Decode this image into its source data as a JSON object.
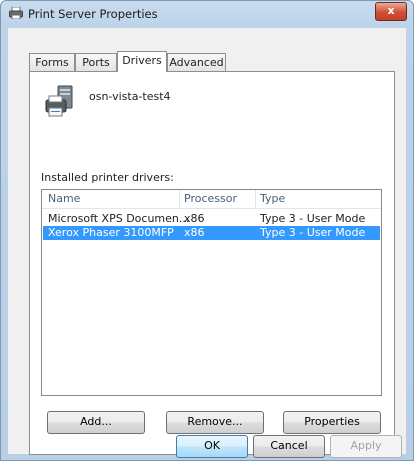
{
  "window": {
    "title": "Print Server Properties",
    "close_glyph": "x"
  },
  "tabs": [
    {
      "label": "Forms",
      "active": false
    },
    {
      "label": "Ports",
      "active": false
    },
    {
      "label": "Drivers",
      "active": true
    },
    {
      "label": "Advanced",
      "active": false
    }
  ],
  "server": {
    "name": "osn-vista-test4",
    "icon": "printer-server-icon"
  },
  "drivers": {
    "label": "Installed printer drivers:",
    "columns": [
      "Name",
      "Processor",
      "Type"
    ],
    "rows": [
      {
        "name": "Microsoft XPS Documen...",
        "processor": "x86",
        "type": "Type 3 - User Mode",
        "selected": false
      },
      {
        "name": "Xerox Phaser 3100MFP",
        "processor": "x86",
        "type": "Type 3 - User Mode",
        "selected": true
      }
    ]
  },
  "panel_buttons": {
    "add": "Add...",
    "remove": "Remove...",
    "properties": "Properties"
  },
  "dialog_buttons": {
    "ok": "OK",
    "cancel": "Cancel",
    "apply": "Apply"
  },
  "colors": {
    "selection": "#3399ff",
    "titlebar": "#bcd3ea",
    "close": "#c94a30"
  }
}
